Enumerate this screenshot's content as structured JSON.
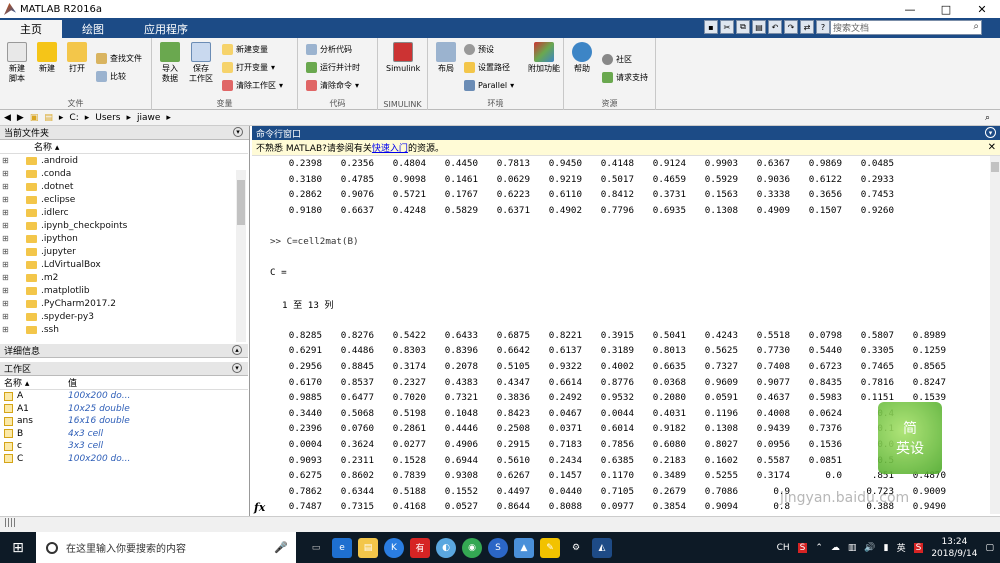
{
  "window": {
    "title": "MATLAB R2016a",
    "min": "—",
    "max": "□",
    "close": "✕"
  },
  "tabs": [
    "主页",
    "绘图",
    "应用程序"
  ],
  "search_docs": {
    "placeholder": "搜索文档",
    "icon": "search-icon"
  },
  "ribbon": {
    "file": {
      "label": "文件",
      "new_script": "新建\n脚本",
      "new": "新建",
      "open": "打开",
      "find_files": "查找文件",
      "compare": "比较"
    },
    "variable": {
      "label": "变量",
      "import": "导入\n数据",
      "save": "保存\n工作区",
      "new_var": "新建变量",
      "open_var": "打开变量",
      "clear_ws": "清除工作区"
    },
    "code": {
      "label": "代码",
      "analyze": "分析代码",
      "run_time": "运行并计时",
      "clear_cmd": "清除命令"
    },
    "simulink": {
      "label": "SIMULINK",
      "simulink": "Simulink"
    },
    "env": {
      "label": "环境",
      "layout": "布局",
      "prefs": "预设",
      "set_path": "设置路径",
      "parallel": "Parallel",
      "addons": "附加功能"
    },
    "resources": {
      "label": "资源",
      "help": "帮助",
      "community": "社区",
      "support": "请求支持"
    }
  },
  "address": {
    "parts": [
      "C:",
      "Users",
      "jiawe"
    ]
  },
  "current_folder": {
    "title": "当前文件夹",
    "col_name": "名称 ▴",
    "items": [
      ".android",
      ".conda",
      ".dotnet",
      ".eclipse",
      ".idlerc",
      ".ipynb_checkpoints",
      ".ipython",
      ".jupyter",
      ".LdVirtualBox",
      ".m2",
      ".matplotlib",
      ".PyCharm2017.2",
      ".spyder-py3",
      ".ssh"
    ]
  },
  "details": {
    "title": "详细信息"
  },
  "workspace": {
    "title": "工作区",
    "col_name": "名称 ▴",
    "col_value": "值",
    "rows": [
      {
        "name": "A",
        "value": "100x200 do..."
      },
      {
        "name": "A1",
        "value": "10x25 double"
      },
      {
        "name": "ans",
        "value": "16x16 double"
      },
      {
        "name": "B",
        "value": "4x3 cell"
      },
      {
        "name": "c",
        "value": "3x3 cell"
      },
      {
        "name": "C",
        "value": "100x200 do..."
      }
    ]
  },
  "command_window": {
    "title": "命令行窗口",
    "notice_pre": "不熟悉 MATLAB?请参阅有关",
    "notice_link": "快速入门",
    "notice_post": "的资源。",
    "top_rows": [
      [
        "0.2398",
        "0.2356",
        "0.4804",
        "0.4450",
        "0.7813",
        "0.9450",
        "0.4148",
        "0.9124",
        "0.9903",
        "0.6367",
        "0.9869",
        "0.0485"
      ],
      [
        "0.3180",
        "0.4785",
        "0.9098",
        "0.1461",
        "0.0629",
        "0.9219",
        "0.5017",
        "0.4659",
        "0.5929",
        "0.9036",
        "0.6122",
        "0.2933"
      ],
      [
        "0.2862",
        "0.9076",
        "0.5721",
        "0.1767",
        "0.6223",
        "0.6110",
        "0.8412",
        "0.3731",
        "0.1563",
        "0.3338",
        "0.3656",
        "0.7453"
      ],
      [
        "0.9180",
        "0.6637",
        "0.4248",
        "0.5829",
        "0.6371",
        "0.4902",
        "0.7796",
        "0.6935",
        "0.1308",
        "0.4909",
        "0.1507",
        "0.9260"
      ]
    ],
    "command": ">> C=cell2mat(B)",
    "result_var": "C =",
    "columns_note": "1 至 13 列",
    "rows": [
      [
        "0.8285",
        "0.8276",
        "0.5422",
        "0.6433",
        "0.6875",
        "0.8221",
        "0.3915",
        "0.5041",
        "0.4243",
        "0.5518",
        "0.0798",
        "0.5807",
        "0.8989"
      ],
      [
        "0.6291",
        "0.4486",
        "0.8303",
        "0.8396",
        "0.6642",
        "0.6137",
        "0.3189",
        "0.8013",
        "0.5625",
        "0.7730",
        "0.5440",
        "0.3305",
        "0.1259"
      ],
      [
        "0.2956",
        "0.8845",
        "0.3174",
        "0.2078",
        "0.5105",
        "0.9322",
        "0.4002",
        "0.6635",
        "0.7327",
        "0.7408",
        "0.6723",
        "0.7465",
        "0.8565"
      ],
      [
        "0.6170",
        "0.8537",
        "0.2327",
        "0.4383",
        "0.4347",
        "0.6614",
        "0.8776",
        "0.0368",
        "0.9609",
        "0.9077",
        "0.8435",
        "0.7816",
        "0.8247"
      ],
      [
        "0.9885",
        "0.6477",
        "0.7020",
        "0.7321",
        "0.3836",
        "0.2492",
        "0.9532",
        "0.2080",
        "0.0591",
        "0.4637",
        "0.5983",
        "0.1151",
        "0.1539"
      ],
      [
        "0.3440",
        "0.5068",
        "0.5198",
        "0.1048",
        "0.8423",
        "0.0467",
        "0.0044",
        "0.4031",
        "0.1196",
        "0.4008",
        "0.0624",
        "0.4",
        ""
      ],
      [
        "0.2396",
        "0.0760",
        "0.2861",
        "0.4446",
        "0.2508",
        "0.0371",
        "0.6014",
        "0.9182",
        "0.1308",
        "0.9439",
        "0.7376",
        "0.1",
        ""
      ],
      [
        "0.0004",
        "0.3624",
        "0.0277",
        "0.4906",
        "0.2915",
        "0.7183",
        "0.7856",
        "0.6080",
        "0.8027",
        "0.0956",
        "0.1536",
        "0.0",
        ""
      ],
      [
        "0.9093",
        "0.2311",
        "0.1528",
        "0.6944",
        "0.5610",
        "0.2434",
        "0.6385",
        "0.2183",
        "0.1602",
        "0.5587",
        "0.0851",
        "0.5",
        ""
      ],
      [
        "0.6275",
        "0.8602",
        "0.7839",
        "0.9308",
        "0.6267",
        "0.1457",
        "0.1170",
        "0.3489",
        "0.5255",
        "0.3174",
        "0.0",
        ".851",
        "0.4870"
      ],
      [
        "0.7862",
        "0.6344",
        "0.5188",
        "0.1552",
        "0.4497",
        "0.0440",
        "0.7105",
        "0.2679",
        "0.7086",
        "0.9",
        "",
        "0.723",
        "0.9009"
      ],
      [
        "0.7487",
        "0.7315",
        "0.4168",
        "0.0527",
        "0.8644",
        "0.8088",
        "0.0977",
        "0.3854",
        "0.9094",
        "0.8",
        "",
        "0.388",
        "0.9490"
      ]
    ],
    "fx": "fx"
  },
  "taskbar": {
    "search_placeholder": "在这里输入你要搜索的内容",
    "lang": "CH",
    "ime": "英",
    "time": "13:24",
    "date": "2018/9/14"
  },
  "watermark": {
    "text": "简\n英设",
    "site": "jingyan.baidu.com"
  }
}
